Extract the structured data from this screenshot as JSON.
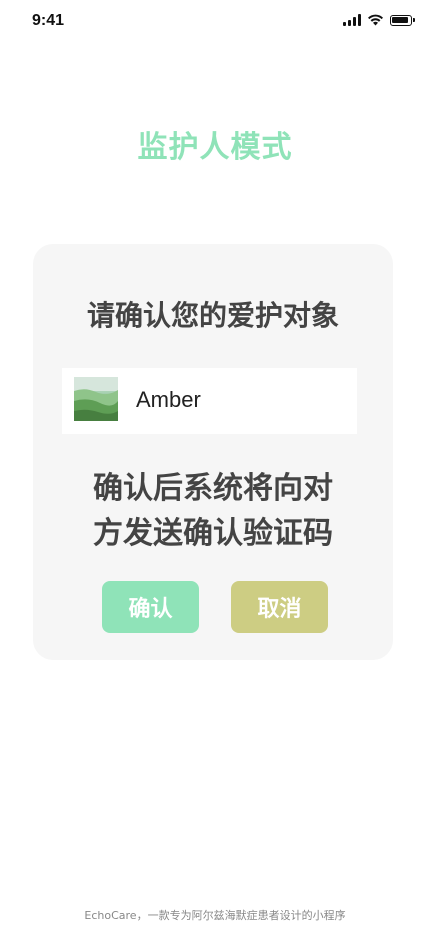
{
  "status_bar": {
    "time": "9:41"
  },
  "page": {
    "title": "监护人模式"
  },
  "card": {
    "heading": "请确认您的爱护对象",
    "person": {
      "name": "Amber"
    },
    "message_lines": [
      "确认后系统将向对",
      "方发送确认验证码"
    ],
    "confirm_label": "确认",
    "cancel_label": "取消"
  },
  "footer": {
    "text": "EchoCare，一款专为阿尔兹海默症患者设计的小程序"
  },
  "colors": {
    "title_green": "#8fe3b8",
    "confirm_green": "#8fe3b8",
    "cancel_olive": "#cdcd83",
    "card_bg": "#f6f6f6"
  }
}
